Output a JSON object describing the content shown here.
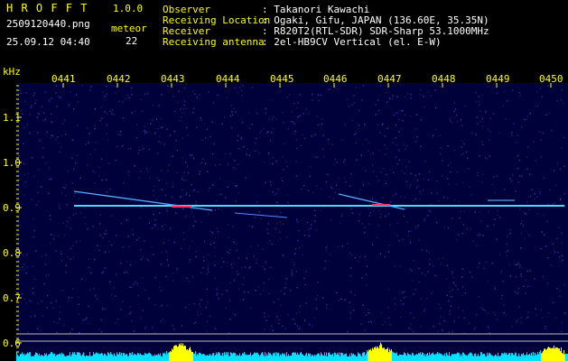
{
  "header": {
    "app_name": "H R O F F T",
    "version": "1.0.0",
    "filename": "2509120440.png",
    "datetime": "25.09.12 04:40",
    "meteor_label": "meteor",
    "meteor_count": "22",
    "info_labels": [
      "Observer",
      "Receiving Location",
      "Receiver",
      "Receiving antenna"
    ],
    "info_values": [
      ": Takanori Kawachi",
      ": Ogaki, Gifu, JAPAN (136.60E, 35.35N)",
      ": R820T2(RTL-SDR) SDR-Sharp 53.1000MHz",
      ": 2el-HB9CV Vertical (el. E-W)"
    ]
  },
  "axis": {
    "y_unit": "kHz",
    "y_ticks": [
      "1.1",
      "1.0",
      "0.9",
      "0.8",
      "0.7",
      "0.6"
    ],
    "x_ticks": [
      "0441",
      "0442",
      "0443",
      "0444",
      "0445",
      "0446",
      "0447",
      "0448",
      "0449",
      "0450"
    ]
  },
  "colors": {
    "background": "#00003a",
    "accent_yellow": "#ffff00",
    "accent_cyan": "#00ffff",
    "carrier": "#4fd8ff"
  }
}
